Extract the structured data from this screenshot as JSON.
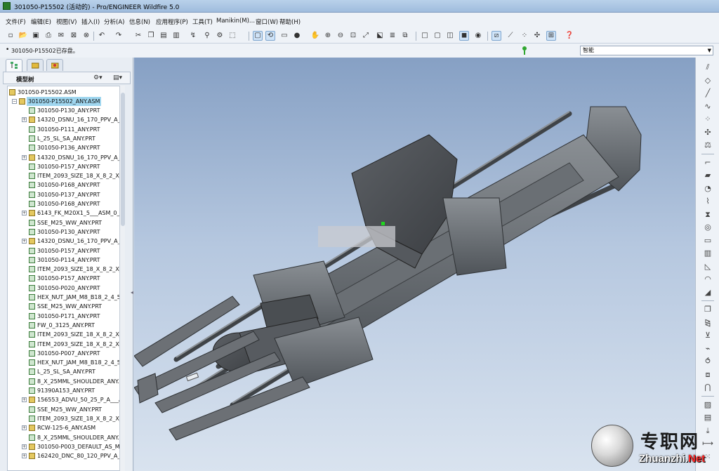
{
  "window": {
    "title": "301050-P15502 (活动的) - Pro/ENGINEER Wildfire 5.0"
  },
  "menu": [
    "文件(F)",
    "编辑(E)",
    "视图(V)",
    "插入(I)",
    "分析(A)",
    "信息(N)",
    "应用程序(P)",
    "工具(T)",
    "Manikin(M)...",
    "窗口(W)",
    "帮助(H)"
  ],
  "message": {
    "text": "301050-P15502已存盘。"
  },
  "filter": {
    "value": "智能"
  },
  "panel": {
    "header": "模型树"
  },
  "tree": {
    "root": "301050-P15502.ASM",
    "selected": "301050-P15502_ANY.ASM",
    "items": [
      {
        "label": "301050-P130_ANY.PRT",
        "type": "part",
        "exp": false
      },
      {
        "label": "14320_DSNU_16_170_PPV_A___",
        "type": "asm",
        "exp": true
      },
      {
        "label": "301050-P111_ANY.PRT",
        "type": "part",
        "exp": false
      },
      {
        "label": "L_25_SL_SA_ANY.PRT",
        "type": "part",
        "exp": false
      },
      {
        "label": "301050-P136_ANY.PRT",
        "type": "part",
        "exp": false
      },
      {
        "label": "14320_DSNU_16_170_PPV_A___",
        "type": "asm",
        "exp": true
      },
      {
        "label": "301050-P157_ANY.PRT",
        "type": "part",
        "exp": false
      },
      {
        "label": "ITEM_2093_SIZE_18_X_8_2_X_C",
        "type": "part",
        "exp": false
      },
      {
        "label": "301050-P168_ANY.PRT",
        "type": "part",
        "exp": false
      },
      {
        "label": "301050-P137_ANY.PRT",
        "type": "part",
        "exp": false
      },
      {
        "label": "301050-P168_ANY.PRT",
        "type": "part",
        "exp": false
      },
      {
        "label": "6143_FK_M20X1_5___ASM_0_0",
        "type": "asm",
        "exp": true
      },
      {
        "label": "SSE_M25_WW_ANY.PRT",
        "type": "part",
        "exp": false
      },
      {
        "label": "301050-P130_ANY.PRT",
        "type": "part",
        "exp": false
      },
      {
        "label": "14320_DSNU_16_170_PPV_A___",
        "type": "asm",
        "exp": true
      },
      {
        "label": "301050-P157_ANY.PRT",
        "type": "part",
        "exp": false
      },
      {
        "label": "301050-P114_ANY.PRT",
        "type": "part",
        "exp": false
      },
      {
        "label": "ITEM_2093_SIZE_18_X_8_2_X_C",
        "type": "part",
        "exp": false
      },
      {
        "label": "301050-P157_ANY.PRT",
        "type": "part",
        "exp": false
      },
      {
        "label": "301050-P020_ANY.PRT",
        "type": "part",
        "exp": false
      },
      {
        "label": "HEX_NUT_JAM_M8_B18_2_4_5",
        "type": "part",
        "exp": false
      },
      {
        "label": "SSE_M25_WW_ANY.PRT",
        "type": "part",
        "exp": false
      },
      {
        "label": "301050-P171_ANY.PRT",
        "type": "part",
        "exp": false
      },
      {
        "label": "FW_0_3125_ANY.PRT",
        "type": "part",
        "exp": false
      },
      {
        "label": "ITEM_2093_SIZE_18_X_8_2_X_C",
        "type": "part",
        "exp": false
      },
      {
        "label": "ITEM_2093_SIZE_18_X_8_2_X_C",
        "type": "part",
        "exp": false
      },
      {
        "label": "301050-P007_ANY.PRT",
        "type": "part",
        "exp": false
      },
      {
        "label": "HEX_NUT_JAM_M8_B18_2_4_5",
        "type": "part",
        "exp": false
      },
      {
        "label": "L_25_SL_SA_ANY.PRT",
        "type": "part",
        "exp": false
      },
      {
        "label": "8_X_25MML_SHOULDER_ANY.",
        "type": "part",
        "exp": false
      },
      {
        "label": "91390A153_ANY.PRT",
        "type": "part",
        "exp": false
      },
      {
        "label": "156553_ADVU_50_25_P_A___A",
        "type": "asm",
        "exp": true
      },
      {
        "label": "SSE_M25_WW_ANY.PRT",
        "type": "part",
        "exp": false
      },
      {
        "label": "ITEM_2093_SIZE_18_X_8_2_X_C",
        "type": "part",
        "exp": false
      },
      {
        "label": "RCW-125-6_ANY.ASM",
        "type": "asm",
        "exp": true
      },
      {
        "label": "8_X_25MML_SHOULDER_ANY.",
        "type": "part",
        "exp": false
      },
      {
        "label": "301050-P003_DEFAULT_AS_M",
        "type": "asm",
        "exp": true
      },
      {
        "label": "162420_DNC_80_120_PPV_A_K",
        "type": "asm",
        "exp": true
      }
    ]
  },
  "icons": {
    "toolbar": [
      "new-icon",
      "open-icon",
      "save-icon",
      "print-icon",
      "email-icon",
      "close-window-icon",
      "undo-icon",
      "redo-icon",
      "cut-icon",
      "copy-icon",
      "paste-icon",
      "paste-special-icon",
      "regenerate-icon",
      "find-icon",
      "select-box-icon",
      "refit-icon",
      "spin-center-icon",
      "orient-icon",
      "zoom-in-icon",
      "zoom-out-icon",
      "zoom-fit-icon",
      "reorient-icon",
      "saved-views-icon",
      "layers-icon",
      "wireframe-icon",
      "hidden-line-icon",
      "no-hidden-icon",
      "shading-icon",
      "enhanced-realism-icon",
      "datum-planes-icon",
      "datum-axes-icon",
      "datum-points-icon",
      "coordinate-systems-icon",
      "annotations-icon",
      "whats-this-icon"
    ],
    "right": [
      "datum-plane-icon",
      "datum-axis-icon",
      "datum-curve-icon",
      "sketched-curve-icon",
      "datum-point-icon",
      "coord-sys-icon",
      "analysis-icon",
      "sketch-icon",
      "extrude-icon",
      "revolve-icon",
      "variable-sweep-icon",
      "blend-icon",
      "hole-icon",
      "shell-icon",
      "rib-icon",
      "draft-icon",
      "round-icon",
      "chamfer-icon",
      "copy-feature-icon",
      "mirror-icon",
      "merge-icon",
      "trim-icon",
      "wrap-icon",
      "offset-icon",
      "intersect-icon",
      "solidify-icon",
      "thicken-icon",
      "project-icon",
      "extend-icon",
      "pattern-icon"
    ]
  },
  "watermark": {
    "cn": "专职网",
    "en": "Zhuanzhi.",
    "net": "Net"
  },
  "colors": {
    "viewport_top": "#86a0c4",
    "viewport_bottom": "#d9e3ef",
    "model": "#6f7378",
    "selection": "#9fd6ef"
  }
}
